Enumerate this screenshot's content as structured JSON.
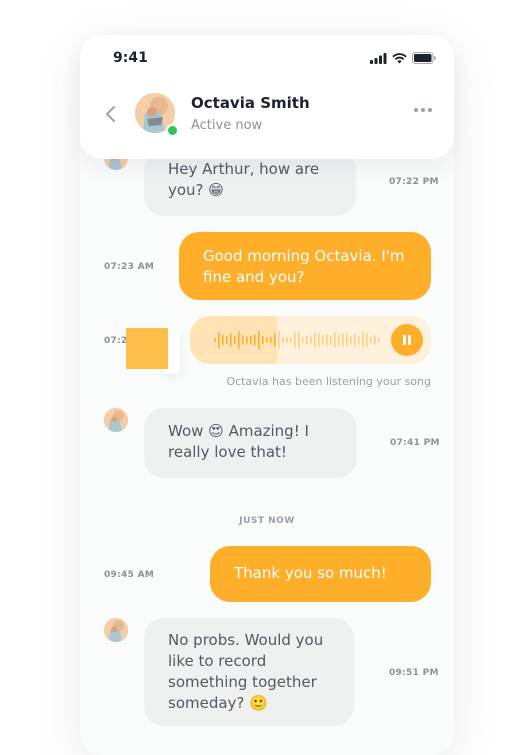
{
  "status_bar": {
    "time": "9:41"
  },
  "header": {
    "contact_name": "Octavia Smith",
    "status": "Active now"
  },
  "messages": [
    {
      "direction": "in",
      "text": "Hey Arthur, how are you? 😁",
      "time": "07:22 PM"
    },
    {
      "direction": "out",
      "text": "Good morning Octavia. I'm fine and you?",
      "time": "07:23 AM"
    },
    {
      "direction": "out",
      "type": "voice",
      "time": "07:2",
      "played_fraction": 0.36,
      "note": "Octavia has been listening your song"
    },
    {
      "direction": "in",
      "text": "Wow 😍 Amazing! I really love that!",
      "time": "07:41 PM"
    },
    {
      "direction": "out",
      "text": "Thank you so much!",
      "time": "09:45 AM"
    },
    {
      "direction": "in",
      "text": "No probs. Would you like to record something together someday? 🙂",
      "time": "09:51 PM"
    }
  ],
  "divider": "JUST NOW",
  "colors": {
    "accent": "#ffae29",
    "incoming_bubble": "#eff1f1",
    "online": "#2dc653",
    "text_dark": "#1c2230",
    "text_muted": "#8c929c"
  }
}
